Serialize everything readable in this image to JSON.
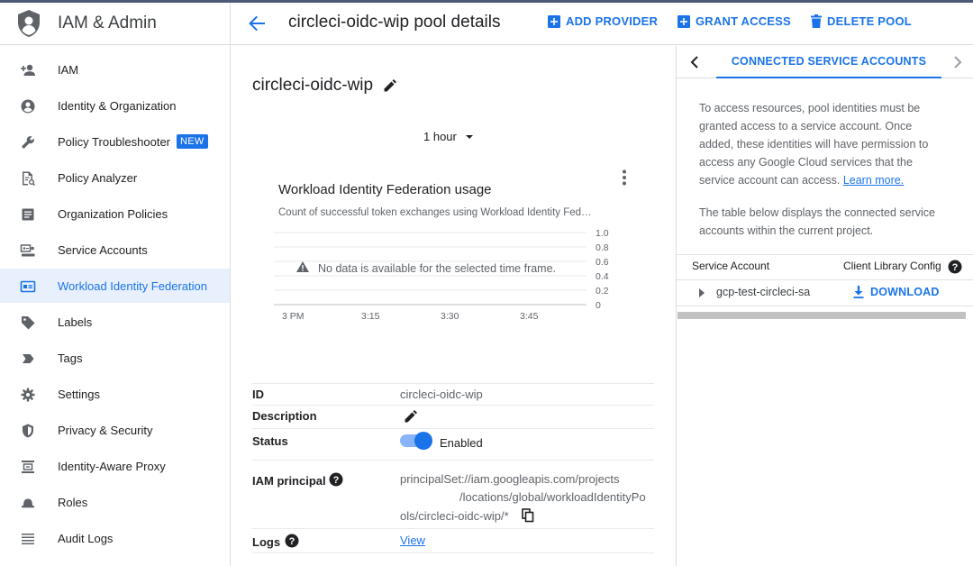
{
  "app": {
    "title": "IAM & Admin"
  },
  "sidebar": {
    "items": [
      {
        "label": "IAM",
        "icon": "person-add-icon"
      },
      {
        "label": "Identity & Organization",
        "icon": "account-circle-icon"
      },
      {
        "label": "Policy Troubleshooter",
        "icon": "wrench-icon",
        "badge": "NEW"
      },
      {
        "label": "Policy Analyzer",
        "icon": "document-search-icon"
      },
      {
        "label": "Organization Policies",
        "icon": "list-document-icon"
      },
      {
        "label": "Service Accounts",
        "icon": "service-account-icon"
      },
      {
        "label": "Workload Identity Federation",
        "icon": "id-card-icon",
        "active": true
      },
      {
        "label": "Labels",
        "icon": "label-tag-icon"
      },
      {
        "label": "Tags",
        "icon": "tag-chevron-icon"
      },
      {
        "label": "Settings",
        "icon": "gear-icon"
      },
      {
        "label": "Privacy & Security",
        "icon": "shield-icon"
      },
      {
        "label": "Identity-Aware Proxy",
        "icon": "proxy-icon"
      },
      {
        "label": "Roles",
        "icon": "roles-hat-icon"
      },
      {
        "label": "Audit Logs",
        "icon": "list-lines-icon"
      }
    ]
  },
  "header": {
    "title": "circleci-oidc-wip pool details",
    "add_provider": "ADD PROVIDER",
    "grant_access": "GRANT ACCESS",
    "delete_pool": "DELETE POOL"
  },
  "main": {
    "pool_name": "circleci-oidc-wip",
    "time_range": "1 hour",
    "no_data": "No data is available for the selected time frame."
  },
  "chart_data": {
    "type": "line",
    "title": "Workload Identity Federation usage",
    "subtitle": "Count of successful token exchanges using Workload Identity Fed…",
    "x_ticks": [
      "3 PM",
      "3:15",
      "3:30",
      "3:45"
    ],
    "y_ticks": [
      "1.0",
      "0.8",
      "0.6",
      "0.4",
      "0.2",
      "0"
    ],
    "ylim": [
      0,
      1
    ],
    "series": [],
    "grid": true
  },
  "details": {
    "id_label": "ID",
    "id_value": "circleci-oidc-wip",
    "description_label": "Description",
    "status_label": "Status",
    "status_value": "Enabled",
    "status_enabled": true,
    "principal_label": "IAM principal",
    "principal_line1": "principalSet://iam.googleapis.com/projects",
    "principal_line2": "/locations/global/workloadIdentityPo",
    "principal_line3": "ols/circleci-oidc-wip/*",
    "logs_label": "Logs",
    "logs_link": "View"
  },
  "right_panel": {
    "tab_label": "CONNECTED SERVICE ACCOUNTS",
    "para1_lines": [
      "To access resources, pool identities must be",
      "granted access to a service account. Once",
      "added, these identities will have permission to",
      "access any Google Cloud services that the",
      "service account can access."
    ],
    "learn_more": "Learn more.",
    "para2_lines": [
      "The table below displays the connected service",
      "accounts within the current project."
    ],
    "col_service_account": "Service Account",
    "col_client_config": "Client Library Config",
    "row_account": "gcp-test-circleci-sa",
    "row_download": "DOWNLOAD"
  },
  "colors": {
    "accent": "#1a73e8",
    "active_bg": "#e8f0fe",
    "border": "#dadce0"
  }
}
